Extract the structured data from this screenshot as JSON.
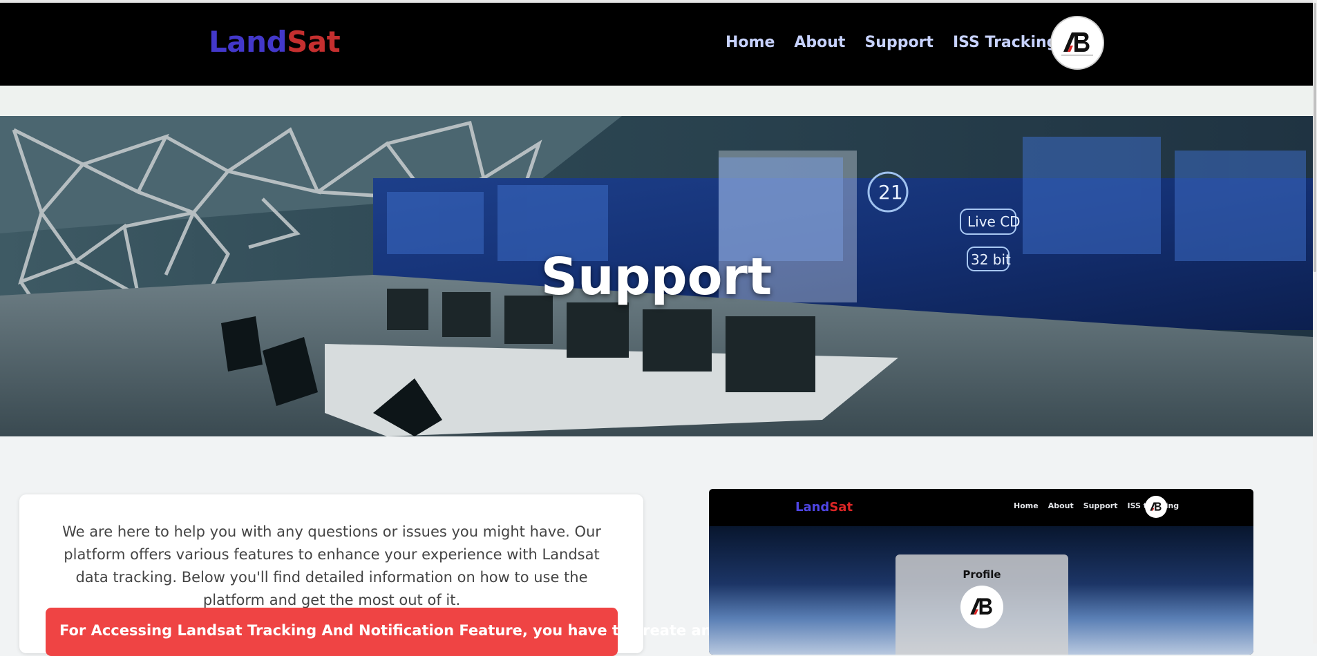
{
  "header": {
    "brand_part1": "Land",
    "brand_part2": "Sat",
    "nav": [
      "Home",
      "About",
      "Support",
      "ISS Tracking"
    ],
    "logo_icon": "ab-company-logo-icon"
  },
  "hero": {
    "title": "Support"
  },
  "intro": {
    "text": "We are here to help you with any questions or issues you might have. Our platform offers various features to enhance your experience with Landsat data tracking. Below you'll find detailed information on how to use the platform and get the most out of it.",
    "alert": "For Accessing Landsat Tracking And Notification Feature, you have to create an"
  },
  "preview": {
    "brand_part1": "Land",
    "brand_part2": "Sat",
    "nav": [
      "Home",
      "About",
      "Support",
      "ISS tracking"
    ],
    "profile_title": "Profile"
  },
  "colors": {
    "brand_land": "#4338ca",
    "brand_sat": "#c52f2f",
    "nav_link": "#c7d2fe",
    "alert_bg": "#ef4444"
  }
}
